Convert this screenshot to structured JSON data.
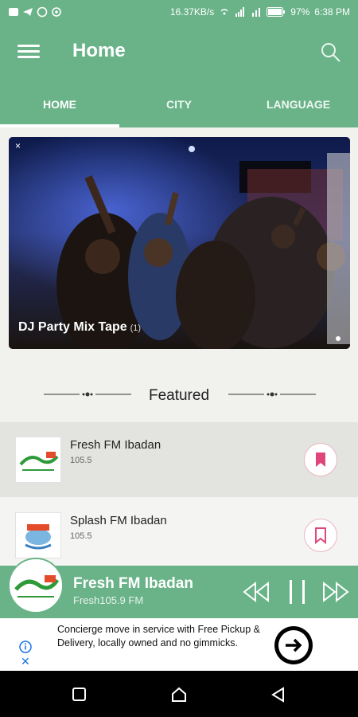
{
  "status_bar": {
    "speed": "16.37KB/s",
    "battery": "97%",
    "time": "6:38 PM"
  },
  "app_bar": {
    "title": "Home"
  },
  "tabs": [
    {
      "label": "HOME",
      "active": true
    },
    {
      "label": "CITY",
      "active": false
    },
    {
      "label": "LANGUAGE",
      "active": false
    }
  ],
  "banner": {
    "close": "×",
    "title": "DJ Party Mix Tape",
    "count": "(1)"
  },
  "featured": {
    "title": "Featured"
  },
  "stations": [
    {
      "name": "Fresh FM Ibadan",
      "freq": "105.5",
      "bookmarked": true
    },
    {
      "name": "Splash FM Ibadan",
      "freq": "105.5",
      "bookmarked": false
    }
  ],
  "player": {
    "name": "Fresh FM Ibadan",
    "sub": "Fresh105.9 FM"
  },
  "ad": {
    "text": "Concierge move in service with Free Pickup & Delivery, locally owned and no gimmicks.",
    "close": "✕"
  },
  "colors": {
    "primary": "#6ab389",
    "bookmark": "#e0457b"
  }
}
